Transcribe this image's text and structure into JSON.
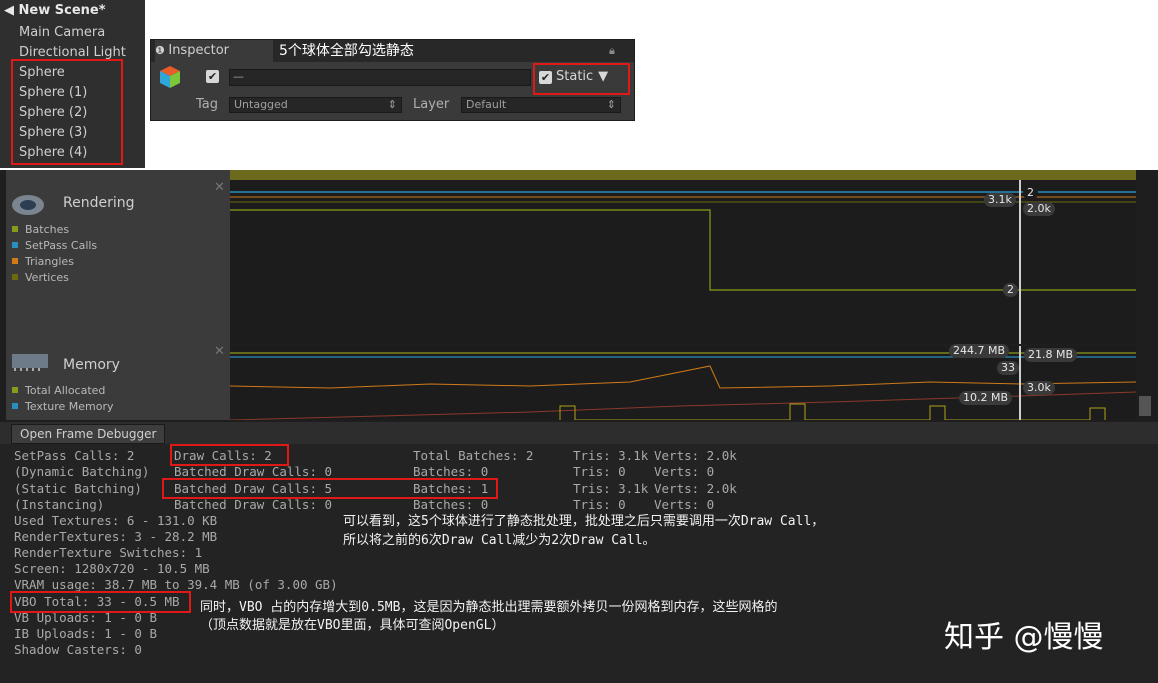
{
  "hierarchy": {
    "scene_title": "New Scene*",
    "items": [
      "Main Camera",
      "Directional Light",
      "Sphere",
      "Sphere (1)",
      "Sphere (2)",
      "Sphere (3)",
      "Sphere (4)"
    ]
  },
  "inspector": {
    "tab_label": "Inspector",
    "annotation": "5个球体全部勾选静态",
    "name_value": "—",
    "static_label": "Static",
    "tag_label": "Tag",
    "tag_value": "Untagged",
    "layer_label": "Layer",
    "layer_value": "Default"
  },
  "profiler": {
    "rendering": {
      "title": "Rendering",
      "legend": [
        "Batches",
        "SetPass Calls",
        "Triangles",
        "Vertices"
      ],
      "value_labels": [
        "3.1k",
        "2",
        "2.0k",
        "2"
      ]
    },
    "memory": {
      "title": "Memory",
      "legend": [
        "Total Allocated",
        "Texture Memory"
      ],
      "value_labels": [
        "244.7 MB",
        "21.8 MB",
        "33",
        "3.0k",
        "10.2 MB"
      ]
    },
    "frame_debugger_button": "Open Frame Debugger",
    "stats_col1": [
      "SetPass Calls: 2",
      "(Dynamic Batching)",
      "(Static Batching)",
      "(Instancing)",
      "Used Textures: 6 - 131.0 KB",
      "RenderTextures: 3 - 28.2 MB",
      "RenderTexture Switches: 1",
      "Screen: 1280x720 - 10.5 MB",
      "VRAM usage: 38.7 MB to 39.4 MB (of 3.00 GB)",
      "VBO Total: 33 - 0.5 MB",
      "VB Uploads: 1 - 0 B",
      "IB Uploads: 1 - 0 B",
      "Shadow Casters: 0"
    ],
    "stats_col2": [
      "Draw Calls: 2",
      "Batched Draw Calls: 0",
      "Batched Draw Calls: 5",
      "Batched Draw Calls: 0"
    ],
    "stats_col3": [
      "Total Batches: 2",
      "Batches: 0",
      "Batches: 1",
      "Batches: 0"
    ],
    "stats_col4": [
      "Tris: 3.1k",
      "Tris: 0",
      "Tris: 3.1k",
      "Tris: 0"
    ],
    "stats_col5": [
      "Verts: 2.0k",
      "Verts: 0",
      "Verts: 2.0k",
      "Verts: 0"
    ]
  },
  "notes": {
    "line1": "可以看到，这5个球体进行了静态批处理，批处理之后只需要调用一次Draw Call，",
    "line2": "所以将之前的6次Draw Call减少为2次Draw Call。",
    "line3": "同时，VBO 占的内存增大到0.5MB，这是因为静态批出理需要额外拷贝一份网格到内存，这些网格的",
    "line4": "（顶点数据就是放在VBO里面，具体可查阅OpenGL）"
  },
  "watermark": "知乎 @慢慢",
  "colors": {
    "highlight": "#e01818",
    "batches": "#8a9a1a",
    "setpass": "#2a8fbf",
    "triangles": "#d07a18",
    "vertices": "#6a6a10"
  }
}
